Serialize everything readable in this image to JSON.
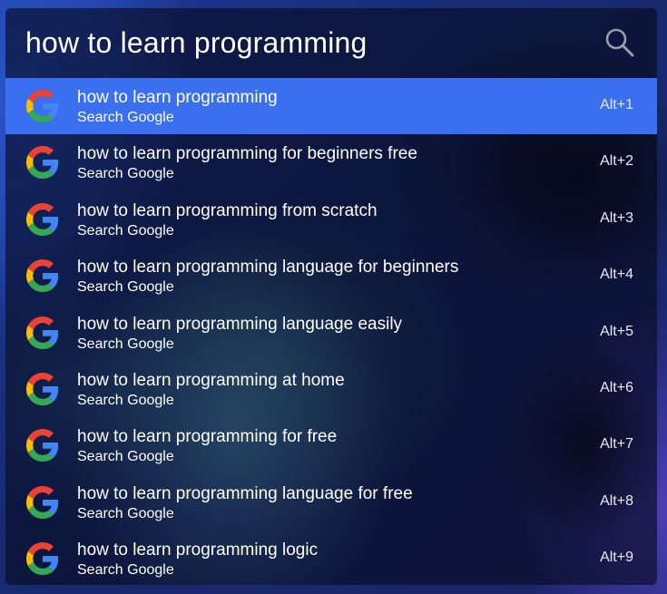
{
  "search": {
    "query": "how to learn programming",
    "icon": "search-icon"
  },
  "results": [
    {
      "title": "how to learn programming",
      "subtitle": "Search Google",
      "shortcut": "Alt+1",
      "selected": true
    },
    {
      "title": "how to learn programming for beginners free",
      "subtitle": "Search Google",
      "shortcut": "Alt+2"
    },
    {
      "title": "how to learn programming from scratch",
      "subtitle": "Search Google",
      "shortcut": "Alt+3"
    },
    {
      "title": "how to learn programming language for beginners",
      "subtitle": "Search Google",
      "shortcut": "Alt+4"
    },
    {
      "title": "how to learn programming language easily",
      "subtitle": "Search Google",
      "shortcut": "Alt+5"
    },
    {
      "title": "how to learn programming at home",
      "subtitle": "Search Google",
      "shortcut": "Alt+6"
    },
    {
      "title": "how to learn programming for free",
      "subtitle": "Search Google",
      "shortcut": "Alt+7"
    },
    {
      "title": "how to learn programming language for free",
      "subtitle": "Search Google",
      "shortcut": "Alt+8"
    },
    {
      "title": "how to learn programming logic",
      "subtitle": "Search Google",
      "shortcut": "Alt+9"
    }
  ],
  "result_icon": "google-g-icon",
  "colors": {
    "selected_row": "#3a6ff0",
    "google_blue": "#4285F4",
    "google_red": "#EA4335",
    "google_yellow": "#FBBC05",
    "google_green": "#34A853"
  }
}
